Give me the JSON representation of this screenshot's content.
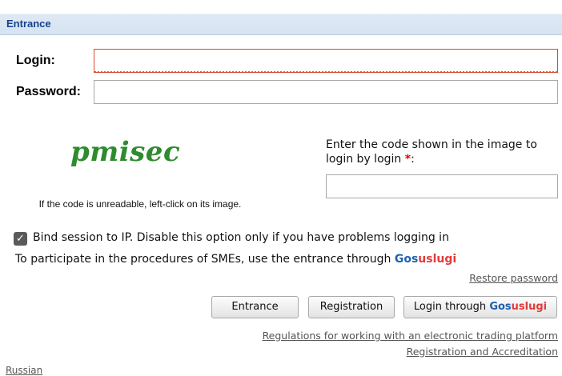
{
  "panel": {
    "title": "Entrance"
  },
  "form": {
    "login_label": "Login:",
    "login_value": "",
    "password_label": "Password:",
    "password_value": ""
  },
  "captcha": {
    "image_text": "pmisec",
    "hint": "If the code is unreadable, left-click on its image.",
    "prompt": "Enter the code shown in the image to login by login",
    "required_mark": "*",
    "prompt_suffix": ":",
    "value": ""
  },
  "options": {
    "bind_ip_checked": true,
    "bind_ip_label": "Bind session to IP. Disable this option only if you have problems logging in",
    "sme_text": "To participate in the procedures of SMEs, use the entrance through",
    "gos_part1": "Gos",
    "gos_part2": "uslugi"
  },
  "links": {
    "restore_password": "Restore password",
    "regulations": "Regulations for working with an electronic trading platform",
    "registration_accreditation": "Registration and Accreditation",
    "language": "Russian"
  },
  "buttons": {
    "entrance": "Entrance",
    "registration": "Registration",
    "login_through": "Login through",
    "gos_part1": "Gos",
    "gos_part2": "uslugi"
  },
  "colors": {
    "header_text": "#15428b",
    "gos_blue": "#1f5fb0",
    "gos_red": "#e53a3a",
    "captcha_green": "#2e8b2e",
    "required_red": "#dd0000",
    "invalid_border": "#d84a2a"
  },
  "icons": {
    "checkbox": "checkmark-icon"
  }
}
